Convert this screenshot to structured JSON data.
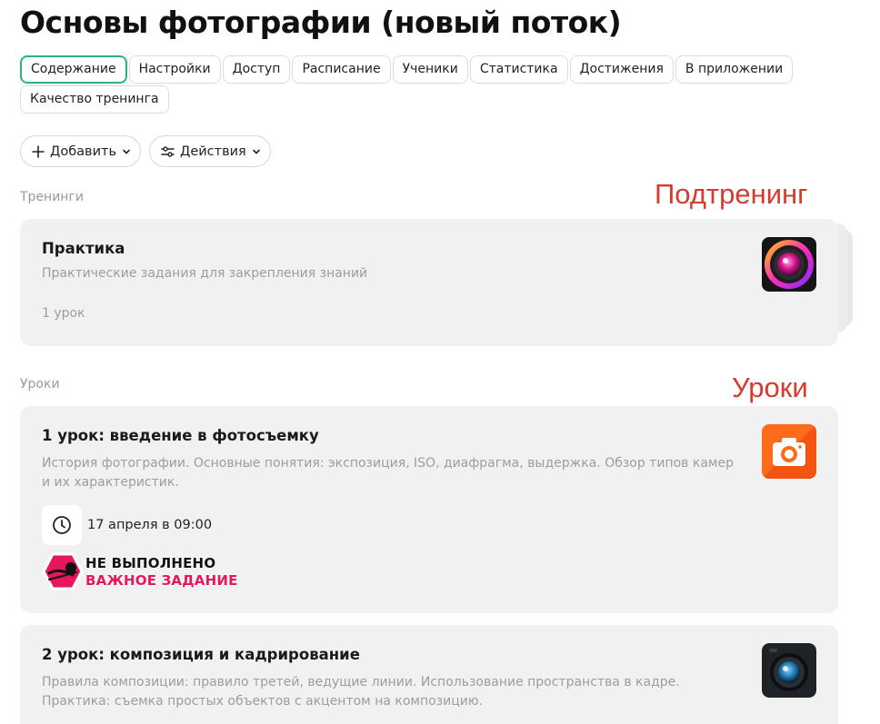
{
  "page": {
    "title": "Основы фотографии (новый поток)"
  },
  "tabs": [
    {
      "label": "Содержание",
      "active": true
    },
    {
      "label": "Настройки"
    },
    {
      "label": "Доступ"
    },
    {
      "label": "Расписание"
    },
    {
      "label": "Ученики"
    },
    {
      "label": "Статистика"
    },
    {
      "label": "Достижения"
    },
    {
      "label": "В приложении"
    },
    {
      "label": "Качество тренинга"
    }
  ],
  "toolbar": {
    "add_label": "Добавить",
    "add_icon": "plus-icon",
    "actions_label": "Действия",
    "actions_icon": "sliders-icon"
  },
  "trainings": {
    "section_label": "Тренинги",
    "annotation": "Подтренинг",
    "items": [
      {
        "title": "Практика",
        "description": "Практические задания для закрепления знаний",
        "meta": "1 урок",
        "thumb_icon": "camera-lens-icon"
      }
    ]
  },
  "lessons": {
    "section_label": "Уроки",
    "annotation": "Уроки",
    "items": [
      {
        "title": "1 урок: введение в фотосъемку",
        "description": "История фотографии. Основные понятия: экспозиция, ISO, диафрагма, выдержка. Обзор типов камер и их характеристик.",
        "date": "17 апреля в 09:00",
        "status_line1": "НЕ ВЫПОЛНЕНО",
        "status_line2": "ВАЖНОЕ ЗАДАНИЕ",
        "thumb_icon": "orange-camera-icon"
      },
      {
        "title": "2 урок: композиция и кадрирование",
        "description": "Правила композиции: правило третей, ведущие линии. Использование пространства в кадре. Практика: съемка простых объектов с акцентом на композицию.",
        "thumb_icon": "dark-lens-icon"
      }
    ]
  },
  "colors": {
    "accent": "#2eb088",
    "annotation": "#d73a2f",
    "important": "#e8175d",
    "card_bg": "#f1f1f1"
  }
}
